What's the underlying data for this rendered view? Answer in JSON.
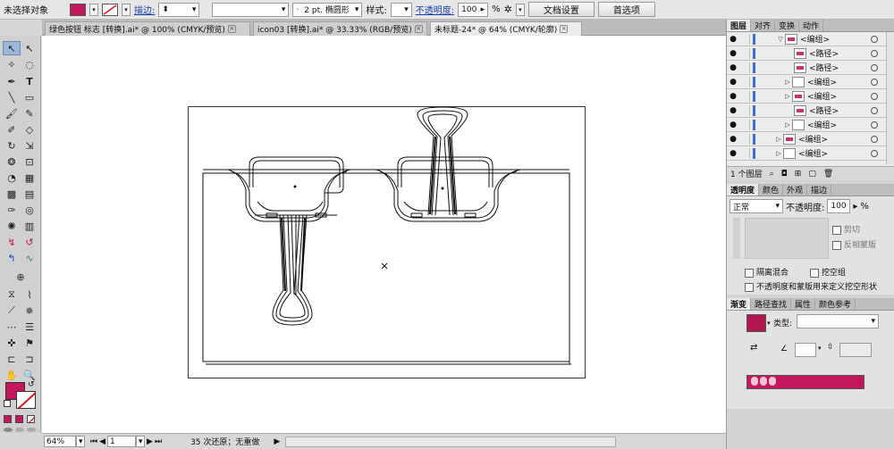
{
  "control_bar": {
    "selection_status": "未选择对象",
    "fill_color": "#c2185b",
    "stroke_label": "描边:",
    "brush_value": "2 pt. 椭圆形",
    "style_label": "样式:",
    "opacity_label": "不透明度:",
    "opacity_value": "100",
    "percent": "%",
    "doc_settings_label": "文档设置",
    "preferences_label": "首选项"
  },
  "tabs": [
    {
      "label": "绿色按钮 标志 [转换].ai* @ 100% (CMYK/预览)"
    },
    {
      "label": "icon03 [转换].ai* @ 33.33% (RGB/预览)"
    },
    {
      "label": "未标题-24* @ 64% (CMYK/轮廓)"
    }
  ],
  "status_bar": {
    "zoom": "64%",
    "artboard_number": "1",
    "undo_info": "35 次还原；无重做"
  },
  "layers_panel": {
    "tabs": [
      "图层",
      "对齐",
      "变换",
      "动作"
    ],
    "rows": [
      {
        "label": "<编组>"
      },
      {
        "label": "<路径>"
      },
      {
        "label": "<路径>"
      },
      {
        "label": "<编组>"
      },
      {
        "label": "<编组>"
      },
      {
        "label": "<路径>"
      },
      {
        "label": "<编组>"
      },
      {
        "label": "<编组>"
      },
      {
        "label": "<编组>"
      }
    ],
    "footer_count": "1 个图层"
  },
  "transparency_panel": {
    "tabs": [
      "透明度",
      "颜色",
      "外观",
      "描边"
    ],
    "blend_mode": "正常",
    "opacity_label": "不透明度:",
    "opacity_value": "100",
    "percent": "%",
    "clip_label": "剪切",
    "invert_mask_label": "反相蒙版",
    "isolate_blending_label": "隔离混合",
    "knockout_group_label": "挖空组",
    "opacity_mask_label": "不透明度和蒙版用来定义挖空形状"
  },
  "gradient_panel": {
    "tabs": [
      "渐变",
      "路径查找",
      "属性",
      "颜色参考"
    ],
    "type_label": "类型:",
    "swatch_color": "#b0174f",
    "bar_color": "#c2185b"
  },
  "colors": {
    "accent_fill": "#c2185b",
    "selection_blue": "#3b6ee0"
  }
}
